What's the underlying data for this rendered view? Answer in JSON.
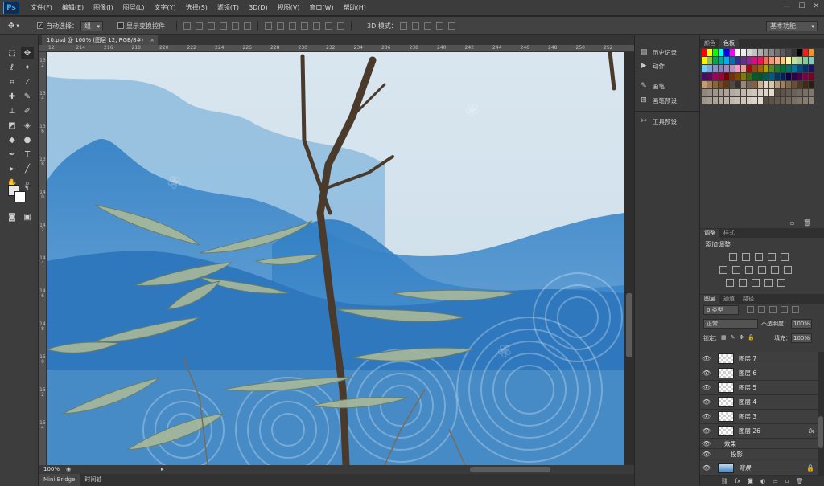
{
  "app": {
    "logo": "Ps"
  },
  "menu": [
    "文件(F)",
    "编辑(E)",
    "图像(I)",
    "图层(L)",
    "文字(Y)",
    "选择(S)",
    "滤镜(T)",
    "3D(D)",
    "视图(V)",
    "窗口(W)",
    "帮助(H)"
  ],
  "window_controls": [
    "—",
    "☐",
    "✕"
  ],
  "options": {
    "auto_select_label": "自动选择：",
    "auto_select_value": "组",
    "show_transform_label": "显示变换控件",
    "mode_3d_label": "3D 模式：",
    "workspace": "基本功能"
  },
  "document": {
    "tab_title": "10.psd @ 100% (图层 12, RGB/8#)",
    "zoom": "100%"
  },
  "ruler": {
    "h": [
      "12",
      "214",
      "216",
      "218",
      "220",
      "222",
      "224",
      "226",
      "228",
      "230",
      "232",
      "234",
      "236",
      "238",
      "240",
      "242",
      "244",
      "246",
      "248",
      "250",
      "252"
    ],
    "v": [
      "132",
      "134",
      "136",
      "138",
      "140",
      "142",
      "144",
      "146",
      "148",
      "150",
      "152",
      "154"
    ]
  },
  "bottom_tabs": [
    "Mini Bridge",
    "时间轴"
  ],
  "mid_panel": {
    "items": [
      {
        "icon": "history-icon",
        "glyph": "▤",
        "label": "历史记录"
      },
      {
        "icon": "actions-icon",
        "glyph": "▶",
        "label": "动作"
      },
      {
        "icon": "brush-icon",
        "glyph": "✎",
        "label": "画笔"
      },
      {
        "icon": "brush-presets-icon",
        "glyph": "⊞",
        "label": "画笔预设"
      },
      {
        "icon": "tool-presets-icon",
        "glyph": "✂",
        "label": "工具预设"
      }
    ]
  },
  "swatch_panel": {
    "tabs": [
      "颜色",
      "色板"
    ]
  },
  "adjust_panel": {
    "tabs": [
      "调整",
      "样式"
    ],
    "title": "添加调整"
  },
  "layers_panel": {
    "tabs": [
      "图层",
      "通道",
      "路径"
    ],
    "filter": "ρ 类型",
    "blend_mode": "正常",
    "opacity_label": "不透明度：",
    "opacity": "100%",
    "lock_label": "锁定：",
    "fill_label": "填充：",
    "fill": "100%",
    "layers": [
      {
        "name": "图层 7"
      },
      {
        "name": "图层 6"
      },
      {
        "name": "图层 5"
      },
      {
        "name": "图层 4"
      },
      {
        "name": "图层 3"
      },
      {
        "name": "图层 26",
        "fx": "fx"
      }
    ],
    "effects_label": "效果",
    "effect_name": "投影",
    "background": "背景"
  }
}
